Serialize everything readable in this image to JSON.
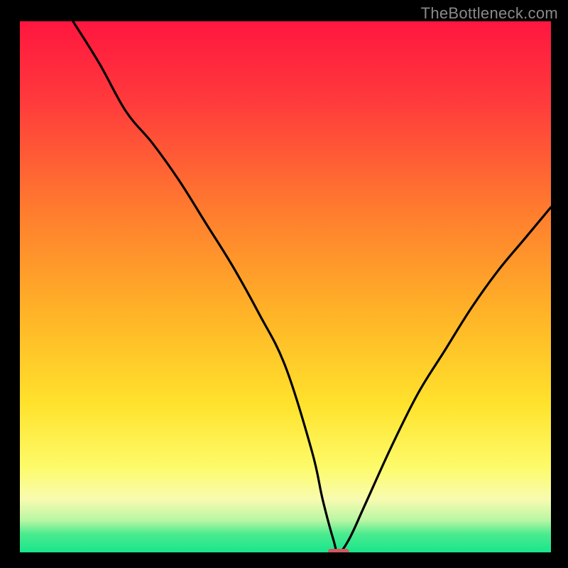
{
  "watermark": "TheBottleneck.com",
  "colors": {
    "frame": "#000000",
    "curve": "#000000",
    "marker": "#cf5a60",
    "gradient_stops": [
      {
        "offset": 0.0,
        "color": "#ff163f"
      },
      {
        "offset": 0.15,
        "color": "#ff3a3c"
      },
      {
        "offset": 0.35,
        "color": "#ff7a2f"
      },
      {
        "offset": 0.55,
        "color": "#ffb327"
      },
      {
        "offset": 0.72,
        "color": "#ffe22c"
      },
      {
        "offset": 0.84,
        "color": "#fdfb6a"
      },
      {
        "offset": 0.9,
        "color": "#f8fbb0"
      },
      {
        "offset": 0.94,
        "color": "#b8f6a3"
      },
      {
        "offset": 0.965,
        "color": "#4ceb8f"
      },
      {
        "offset": 1.0,
        "color": "#18e58c"
      }
    ]
  },
  "chart_data": {
    "type": "line",
    "title": "",
    "xlabel": "",
    "ylabel": "",
    "xlim": [
      0,
      100
    ],
    "ylim": [
      0,
      100
    ],
    "grid": false,
    "legend": "none",
    "series": [
      {
        "name": "bottleneck-curve",
        "x": [
          10,
          15,
          20,
          25,
          30,
          35,
          40,
          45,
          50,
          55,
          57,
          59,
          60,
          62,
          65,
          70,
          75,
          80,
          85,
          90,
          95,
          100
        ],
        "y": [
          100,
          92,
          83,
          77,
          70,
          62,
          54,
          45,
          35,
          19,
          10,
          2.5,
          0,
          2.5,
          9,
          20,
          30,
          38,
          46,
          53,
          59,
          65
        ]
      }
    ],
    "annotations": [
      {
        "name": "optimal-marker",
        "x_range": [
          58,
          62
        ],
        "y": 0
      }
    ]
  }
}
